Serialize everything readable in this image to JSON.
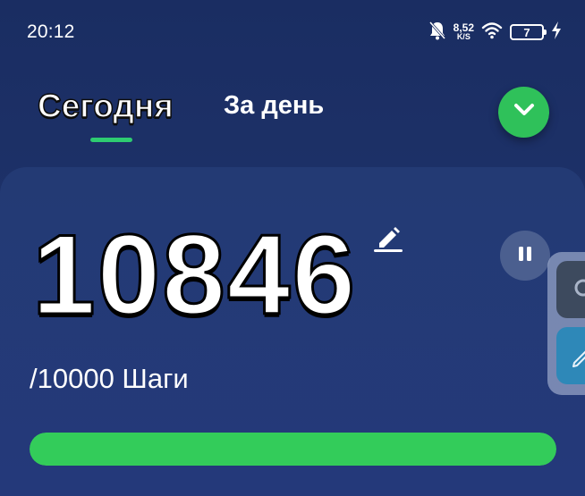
{
  "status_bar": {
    "time": "20:12",
    "net_speed_value": "8,52",
    "net_speed_unit": "K/S",
    "battery_level": "7",
    "icons": [
      "bell-muted-icon",
      "wifi-icon",
      "battery-icon",
      "charging-bolt-icon"
    ]
  },
  "tabs": [
    {
      "label": "Сегодня",
      "active": true
    },
    {
      "label": "За день",
      "active": false
    }
  ],
  "steps": {
    "value": "10846",
    "goal_text": "/10000 Шаги",
    "progress_fraction": 1.0
  },
  "colors": {
    "background": "#1b2f63",
    "card": "#233a74",
    "accent_green": "#33cc5a",
    "pause_button": "#4b5f8f"
  }
}
